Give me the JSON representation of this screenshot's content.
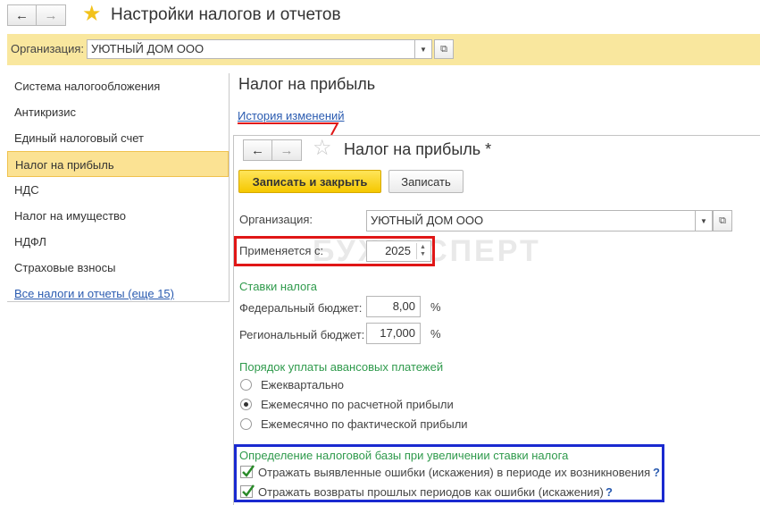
{
  "header": {
    "back_icon": "←",
    "forward_icon": "→",
    "title": "Настройки налогов и отчетов"
  },
  "orgbar": {
    "label": "Организация:",
    "value": "УЮТНЫЙ ДОМ ООО"
  },
  "sidebar": {
    "items": [
      {
        "label": "Система налогообложения"
      },
      {
        "label": "Антикризис"
      },
      {
        "label": "Единый налоговый счет"
      },
      {
        "label": "Налог на прибыль"
      },
      {
        "label": "НДС"
      },
      {
        "label": "Налог на имущество"
      },
      {
        "label": "НДФЛ"
      },
      {
        "label": "Страховые взносы"
      }
    ],
    "all_link": "Все налоги и отчеты (еще 15)"
  },
  "section": {
    "title": "Налог на прибыль",
    "history_link": "История изменений"
  },
  "form": {
    "title": "Налог на прибыль *",
    "save_close_label": "Записать и закрыть",
    "save_label": "Записать",
    "org_label": "Организация:",
    "org_value": "УЮТНЫЙ ДОМ ООО",
    "applies_label": "Применяется с:",
    "applies_value": "2025",
    "watermark": "БУХЭКСПЕРТ",
    "rates_heading": "Ставки налога",
    "federal_label": "Федеральный бюджет:",
    "federal_value": "8,00",
    "regional_label": "Региональный бюджет:",
    "regional_value": "17,000",
    "percent": "%",
    "advance_heading": "Порядок уплаты авансовых платежей",
    "advance_options": [
      {
        "label": "Ежеквартально",
        "selected": false
      },
      {
        "label": "Ежемесячно по расчетной прибыли",
        "selected": true
      },
      {
        "label": "Ежемесячно по фактической прибыли",
        "selected": false
      }
    ],
    "base_heading": "Определение налоговой базы при увеличении ставки налога",
    "base_options": [
      {
        "label": "Отражать выявленные ошибки (искажения) в периоде их возникновения",
        "checked": true
      },
      {
        "label": "Отражать возвраты прошлых периодов как ошибки (искажения)",
        "checked": true
      }
    ],
    "help": "?"
  },
  "colors": {
    "accent_yellow": "#f9e79e",
    "highlight_red": "#e01616",
    "highlight_blue": "#1a2ad0",
    "link_blue": "#2a5bb0",
    "heading_green": "#2f9a4c"
  }
}
